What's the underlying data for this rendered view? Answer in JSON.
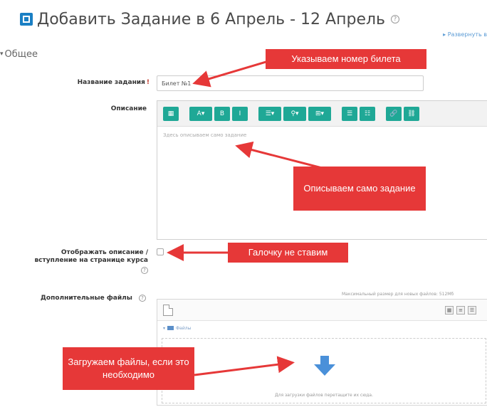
{
  "page": {
    "title": "Добавить Задание в 6 Апрель - 12 Апрель",
    "expand_all": "▸ Развернуть в",
    "section_general": "Общее"
  },
  "form": {
    "name_label": "Название задания",
    "name_required_mark": "!",
    "name_value": "Билет №1",
    "description_label": "Описание",
    "description_placeholder": "Здесь описываем само задание",
    "show_description_label_line1": "Отображать описание /",
    "show_description_label_line2": "вступление на странице курса",
    "additional_files_label": "Дополнительные файлы",
    "max_size_text": "Максимальный размер для новых файлов: 512Мб",
    "files_folder": "Файлы",
    "drop_text": "Для загрузки файлов перетащите их сюда."
  },
  "toolbar": {
    "buttons": [
      "▦",
      "A▾",
      "B",
      "I",
      "☰▾",
      "⚲▾",
      "⊞▾",
      "☰",
      "☷",
      "🔗",
      "⛓"
    ]
  },
  "callouts": {
    "ticket": "Указываем номер билета",
    "describe": "Описываем само задание",
    "checkbox": "Галочку не ставим",
    "upload": "Загружаем файлы, если это необходимо"
  },
  "colors": {
    "callout": "#e63838",
    "toolbar_button": "#1fa896",
    "upload_arrow": "#4a90d9"
  }
}
